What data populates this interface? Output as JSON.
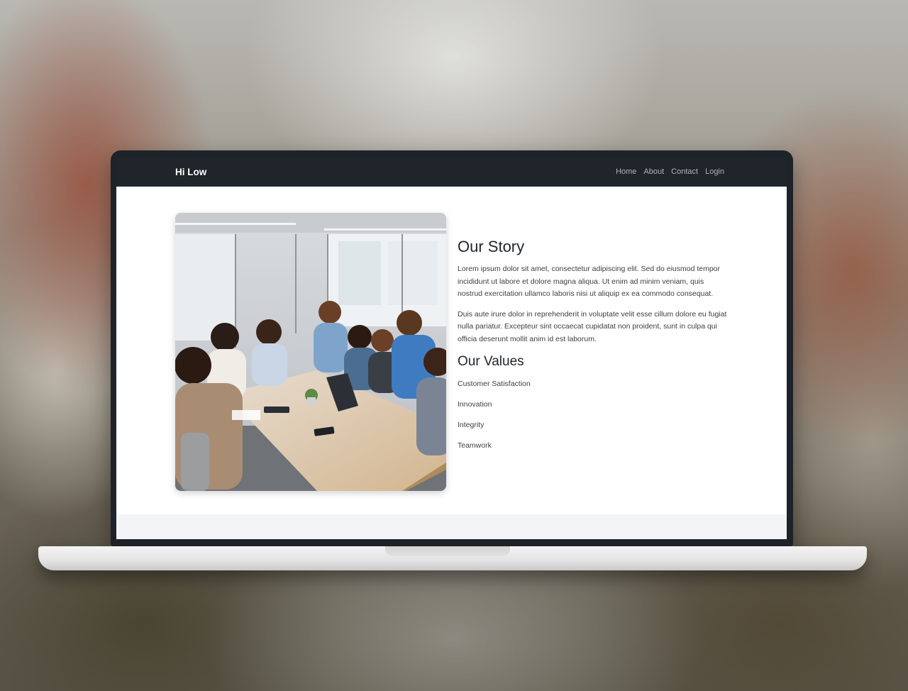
{
  "navbar": {
    "brand": "Hi Low",
    "links": [
      "Home",
      "About",
      "Contact",
      "Login"
    ]
  },
  "story": {
    "heading": "Our Story",
    "paragraphs": [
      "Lorem ipsum dolor sit amet, consectetur adipiscing elit. Sed do eiusmod tempor incididunt ut labore et dolore magna aliqua. Ut enim ad minim veniam, quis nostrud exercitation ullamco laboris nisi ut aliquip ex ea commodo consequat.",
      "Duis aute irure dolor in reprehenderit in voluptate velit esse cillum dolore eu fugiat nulla pariatur. Excepteur sint occaecat cupidatat non proident, sunt in culpa qui officia deserunt mollit anim id est laborum."
    ]
  },
  "values": {
    "heading": "Our Values",
    "items": [
      "Customer Satisfaction",
      "Innovation",
      "Integrity",
      "Teamwork"
    ]
  },
  "colors": {
    "navbar_bg": "#1f252b",
    "laptop_frame": "#1d2329",
    "text": "#3b4046"
  }
}
